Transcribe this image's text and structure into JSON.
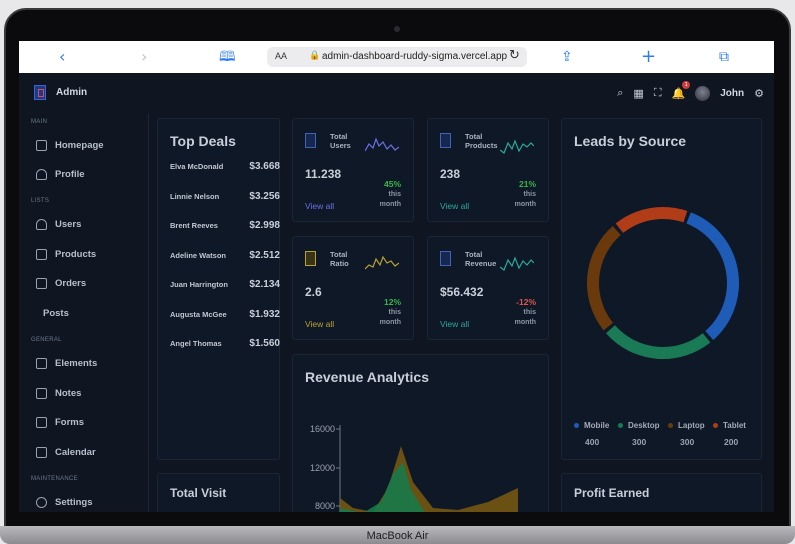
{
  "device": {
    "label": "MacBook Air"
  },
  "browser": {
    "text_size": "AA",
    "url": "admin-dashboard-ruddy-sigma.vercel.app"
  },
  "app": {
    "brand": "Admin",
    "user": "John",
    "notifications": "1"
  },
  "sidebar": {
    "sections": [
      "MAIN",
      "LISTS",
      "GENERAL",
      "MAINTENANCE"
    ],
    "items": [
      {
        "label": "Homepage"
      },
      {
        "label": "Profile"
      },
      {
        "label": "Users"
      },
      {
        "label": "Products"
      },
      {
        "label": "Orders"
      },
      {
        "label": "Posts"
      },
      {
        "label": "Elements"
      },
      {
        "label": "Notes"
      },
      {
        "label": "Forms"
      },
      {
        "label": "Calendar"
      },
      {
        "label": "Settings"
      }
    ]
  },
  "top_deals": {
    "title": "Top Deals",
    "rows": [
      {
        "name": "Elva McDonald",
        "value": "$3.668"
      },
      {
        "name": "Linnie Nelson",
        "value": "$3.256"
      },
      {
        "name": "Brent Reeves",
        "value": "$2.998"
      },
      {
        "name": "Adeline Watson",
        "value": "$2.512"
      },
      {
        "name": "Juan Harrington",
        "value": "$2.134"
      },
      {
        "name": "Augusta McGee",
        "value": "$1.932"
      },
      {
        "name": "Angel Thomas",
        "value": "$1.560"
      }
    ]
  },
  "stats": [
    {
      "title1": "Total",
      "title2": "Users",
      "value": "11.238",
      "pct": "45%",
      "sub1": "this",
      "sub2": "month",
      "link": "View all",
      "color": "#6c6fe8",
      "pct_color": "#3bb54a"
    },
    {
      "title1": "Total",
      "title2": "Products",
      "value": "238",
      "pct": "21%",
      "sub1": "this",
      "sub2": "month",
      "link": "View all",
      "color": "#2ba99b",
      "pct_color": "#3bb54a"
    },
    {
      "title1": "Total",
      "title2": "Ratio",
      "value": "2.6",
      "pct": "12%",
      "sub1": "this",
      "sub2": "month",
      "link": "View all",
      "color": "#b8a230",
      "pct_color": "#3bb54a"
    },
    {
      "title1": "Total",
      "title2": "Revenue",
      "value": "$56.432",
      "pct": "-12%",
      "sub1": "this",
      "sub2": "month",
      "link": "View all",
      "color": "#2ba99b",
      "pct_color": "#e0574a"
    }
  ],
  "leads": {
    "title": "Leads by Source"
  },
  "revenue": {
    "title": "Revenue Analytics"
  },
  "total_visit": {
    "title": "Total Visit"
  },
  "profit": {
    "title": "Profit Earned"
  },
  "chart_data": [
    {
      "type": "pie",
      "title": "Leads by Source",
      "categories": [
        "Mobile",
        "Desktop",
        "Laptop",
        "Tablet"
      ],
      "values": [
        400,
        300,
        300,
        200
      ],
      "colors": [
        "#1f5cb8",
        "#1a7a55",
        "#6b3a0c",
        "#b03d18"
      ],
      "legend": "bottom"
    },
    {
      "type": "area",
      "title": "Revenue Analytics",
      "y_ticks": [
        "16000",
        "12000",
        "8000"
      ],
      "ylim": [
        0,
        16000
      ],
      "grid": false
    }
  ]
}
